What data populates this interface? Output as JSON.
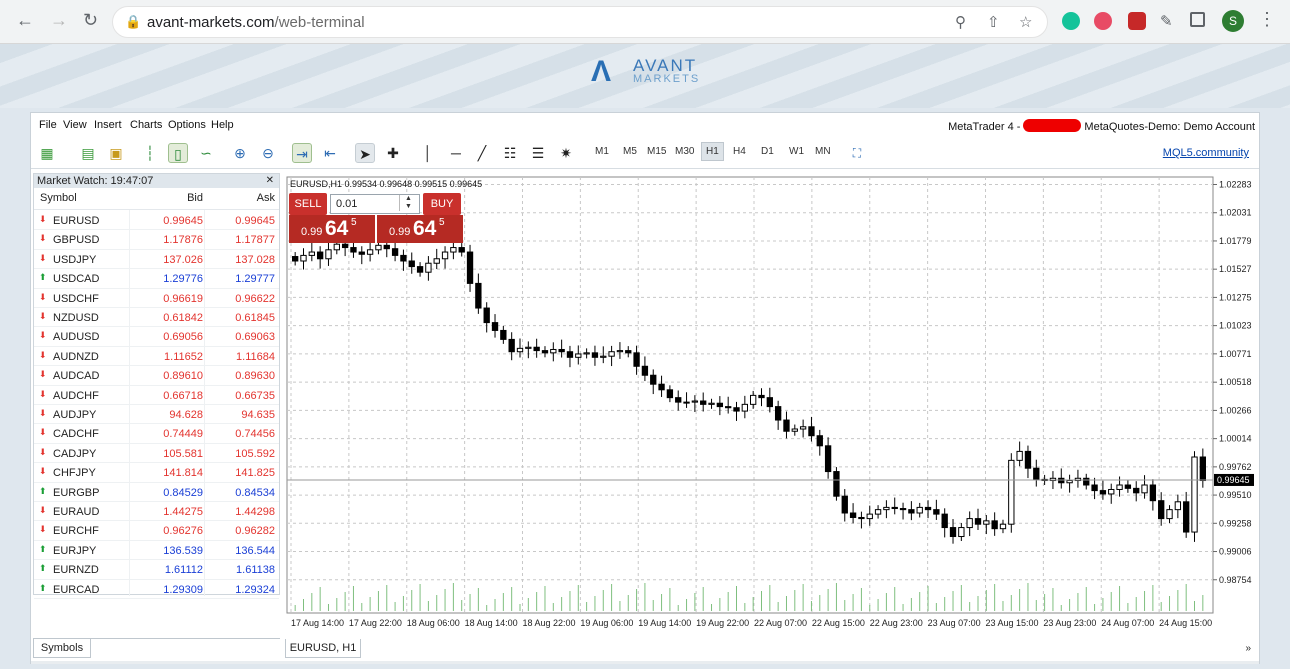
{
  "browser": {
    "url_host": "avant-markets.com",
    "url_path": "/web-terminal",
    "profile_initial": "S"
  },
  "brand": {
    "name_top": "AVANT",
    "name_bottom": "MARKETS"
  },
  "menu": [
    "File",
    "View",
    "Insert",
    "Charts",
    "Options",
    "Help"
  ],
  "account": {
    "prefix": "MetaTrader 4 -",
    "server": "MetaQuotes-Demo: Demo Account"
  },
  "toolbar": {
    "timeframes": [
      "M1",
      "M5",
      "M15",
      "M30",
      "H1",
      "H4",
      "D1",
      "W1",
      "MN"
    ],
    "selected_timeframe": "H1",
    "community_link": "MQL5.community"
  },
  "market_watch": {
    "title": "Market Watch: 19:47:07",
    "columns": {
      "symbol": "Symbol",
      "bid": "Bid",
      "ask": "Ask"
    },
    "rows": [
      {
        "symbol": "EURUSD",
        "bid": "0.99645",
        "ask": "0.99645",
        "dir": "down"
      },
      {
        "symbol": "GBPUSD",
        "bid": "1.17876",
        "ask": "1.17877",
        "dir": "down"
      },
      {
        "symbol": "USDJPY",
        "bid": "137.026",
        "ask": "137.028",
        "dir": "down"
      },
      {
        "symbol": "USDCAD",
        "bid": "1.29776",
        "ask": "1.29777",
        "dir": "up"
      },
      {
        "symbol": "USDCHF",
        "bid": "0.96619",
        "ask": "0.96622",
        "dir": "down"
      },
      {
        "symbol": "NZDUSD",
        "bid": "0.61842",
        "ask": "0.61845",
        "dir": "down"
      },
      {
        "symbol": "AUDUSD",
        "bid": "0.69056",
        "ask": "0.69063",
        "dir": "down"
      },
      {
        "symbol": "AUDNZD",
        "bid": "1.11652",
        "ask": "1.11684",
        "dir": "down"
      },
      {
        "symbol": "AUDCAD",
        "bid": "0.89610",
        "ask": "0.89630",
        "dir": "down"
      },
      {
        "symbol": "AUDCHF",
        "bid": "0.66718",
        "ask": "0.66735",
        "dir": "down"
      },
      {
        "symbol": "AUDJPY",
        "bid": "94.628",
        "ask": "94.635",
        "dir": "down"
      },
      {
        "symbol": "CADCHF",
        "bid": "0.74449",
        "ask": "0.74456",
        "dir": "down"
      },
      {
        "symbol": "CADJPY",
        "bid": "105.581",
        "ask": "105.592",
        "dir": "down"
      },
      {
        "symbol": "CHFJPY",
        "bid": "141.814",
        "ask": "141.825",
        "dir": "down"
      },
      {
        "symbol": "EURGBP",
        "bid": "0.84529",
        "ask": "0.84534",
        "dir": "up"
      },
      {
        "symbol": "EURAUD",
        "bid": "1.44275",
        "ask": "1.44298",
        "dir": "down"
      },
      {
        "symbol": "EURCHF",
        "bid": "0.96276",
        "ask": "0.96282",
        "dir": "down"
      },
      {
        "symbol": "EURJPY",
        "bid": "136.539",
        "ask": "136.544",
        "dir": "up"
      },
      {
        "symbol": "EURNZD",
        "bid": "1.61112",
        "ask": "1.61138",
        "dir": "up"
      },
      {
        "symbol": "EURCAD",
        "bid": "1.29309",
        "ask": "1.29324",
        "dir": "up"
      }
    ],
    "tab_label": "Symbols"
  },
  "trade": {
    "sell_label": "SELL",
    "buy_label": "BUY",
    "lot": "0.01",
    "sell_price": {
      "big": "0.99",
      "pips": "64",
      "frac": "5"
    },
    "buy_price": {
      "big": "0.99",
      "pips": "64",
      "frac": "5"
    }
  },
  "chart_tab_label": "EURUSD, H1",
  "colors": {
    "down": "#e3342f",
    "up": "#1a9e35",
    "bid_down": "#e3342f",
    "bid_up": "#1a3fd6"
  },
  "chart_data": {
    "type": "candlestick",
    "header": "EURUSD,H1  0.99534 0.99648 0.99515 0.99645",
    "y_ticks": [
      "1.02283",
      "1.02031",
      "1.01779",
      "1.01527",
      "1.01275",
      "1.01023",
      "1.00771",
      "1.00518",
      "1.00266",
      "1.00014",
      "0.99762",
      "0.99510",
      "0.99258",
      "0.99006",
      "0.98754"
    ],
    "y_range": [
      0.986,
      1.0235
    ],
    "current_price": "0.99645",
    "x_ticks": [
      "17 Aug 14:00",
      "17 Aug 22:00",
      "18 Aug 06:00",
      "18 Aug 14:00",
      "18 Aug 22:00",
      "19 Aug 06:00",
      "19 Aug 14:00",
      "19 Aug 22:00",
      "22 Aug 07:00",
      "22 Aug 15:00",
      "22 Aug 23:00",
      "23 Aug 07:00",
      "23 Aug 15:00",
      "23 Aug 23:00",
      "24 Aug 07:00",
      "24 Aug 15:00"
    ],
    "close_series": [
      1.016,
      1.0165,
      1.0168,
      1.0162,
      1.017,
      1.0175,
      1.0172,
      1.0168,
      1.0166,
      1.017,
      1.0174,
      1.0171,
      1.0165,
      1.016,
      1.0155,
      1.015,
      1.0158,
      1.0162,
      1.0168,
      1.0172,
      1.0168,
      1.014,
      1.0118,
      1.0105,
      1.0098,
      1.009,
      1.0079,
      1.0082,
      1.0083,
      1.008,
      1.0078,
      1.0081,
      1.0079,
      1.0074,
      1.0077,
      1.0078,
      1.0074,
      1.0075,
      1.0079,
      1.008,
      1.0078,
      1.0066,
      1.0058,
      1.005,
      1.0045,
      1.0038,
      1.0034,
      1.0034,
      1.0035,
      1.0032,
      1.0033,
      1.003,
      1.0029,
      1.0026,
      1.0032,
      1.004,
      1.0038,
      1.003,
      1.0018,
      1.0008,
      1.001,
      1.0012,
      1.0004,
      0.9995,
      0.9972,
      0.995,
      0.9935,
      0.9931,
      0.993,
      0.9934,
      0.9938,
      0.994,
      0.9939,
      0.9938,
      0.9935,
      0.994,
      0.9938,
      0.9934,
      0.9922,
      0.9914,
      0.9922,
      0.993,
      0.9925,
      0.9928,
      0.9921,
      0.9925,
      0.9982,
      0.999,
      0.9975,
      0.9965,
      0.9964,
      0.9966,
      0.9962,
      0.9964,
      0.9966,
      0.996,
      0.9955,
      0.9952,
      0.9956,
      0.996,
      0.9957,
      0.9953,
      0.996,
      0.9946,
      0.993,
      0.9938,
      0.9945,
      0.9918,
      0.9985,
      0.9964
    ]
  }
}
